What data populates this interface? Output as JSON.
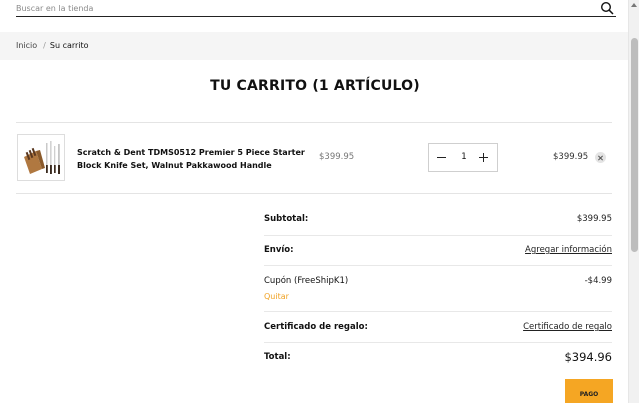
{
  "search": {
    "placeholder": "Buscar en la tienda",
    "icon": "search-icon"
  },
  "breadcrumb": {
    "home": "Inicio",
    "separator": "/",
    "current": "Su carrito"
  },
  "page_title": "TU CARRITO (1 ARTÍCULO)",
  "cart_item": {
    "name": "Scratch & Dent TDMS0512 Premier 5 Piece Starter Block Knife Set, Walnut Pakkawood Handle",
    "unit_price": "$399.95",
    "quantity": "1",
    "line_total": "$399.95"
  },
  "summary": {
    "subtotal_label": "Subtotal:",
    "subtotal_value": "$399.95",
    "shipping_label": "Envío:",
    "shipping_value": "Agregar información",
    "coupon_label": "Cupón (FreeShipK1)",
    "coupon_value": "-$4.99",
    "coupon_remove": "Quitar",
    "gift_label": "Certificado de regalo:",
    "gift_value": "Certificado de regalo",
    "total_label": "Total:",
    "total_value": "$394.96"
  },
  "checkout_button": "PAGO",
  "colors": {
    "accent": "#f5a623",
    "link_accent": "#f0a224",
    "band": "#f5f5f5"
  }
}
